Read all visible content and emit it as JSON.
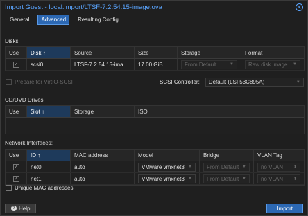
{
  "window": {
    "title": "Import Guest - local:import/LTSF-7.2.54.15-image.ova"
  },
  "tabs": [
    {
      "label": "General"
    },
    {
      "label": "Advanced"
    },
    {
      "label": "Resulting Config"
    }
  ],
  "disks": {
    "section_label": "Disks:",
    "headers": [
      "Use",
      "Disk ↑",
      "Source",
      "Size",
      "Storage",
      "Format"
    ],
    "rows": [
      {
        "disk": "scsi0",
        "source": "LTSF-7.2.54.15-ima...",
        "size": "17.00 GiB",
        "storage": "From Default",
        "format": "Raw disk image"
      }
    ]
  },
  "virtio": {
    "label": "Prepare for VirtIO-SCSI"
  },
  "scsi": {
    "label": "SCSI Controller:",
    "value": "Default (LSI 53C895A)"
  },
  "cdrom": {
    "section_label": "CD/DVD Drives:",
    "headers": [
      "Use",
      "Slot ↑",
      "Storage",
      "ISO"
    ]
  },
  "network": {
    "section_label": "Network Interfaces:",
    "headers": [
      "Use",
      "ID ↑",
      "MAC address",
      "Model",
      "Bridge",
      "VLAN Tag"
    ],
    "rows": [
      {
        "id": "net0",
        "mac": "auto",
        "model": "VMware vmxnet3",
        "bridge": "From Default",
        "vlan": "no VLAN"
      },
      {
        "id": "net1",
        "mac": "auto",
        "model": "VMware vmxnet3",
        "bridge": "From Default",
        "vlan": "no VLAN"
      }
    ]
  },
  "unique_mac": {
    "label": "Unique MAC addresses"
  },
  "footer": {
    "help_label": "Help",
    "import_label": "Import"
  },
  "colors": {
    "accent": "#2c68b3",
    "title": "#5aa5ff"
  }
}
